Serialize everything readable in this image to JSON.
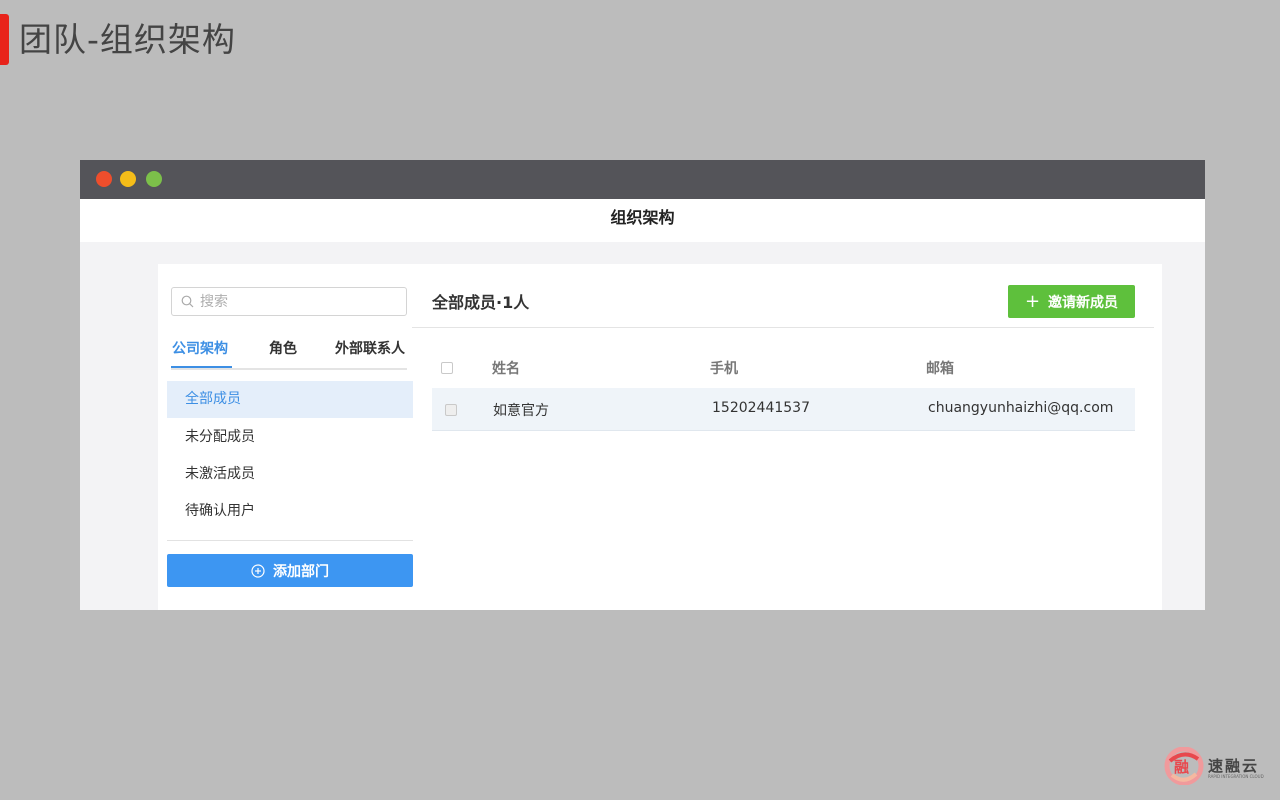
{
  "slide": {
    "title": "团队-组织架构"
  },
  "window": {
    "header_title": "组织架构"
  },
  "sidebar": {
    "search_placeholder": "搜索",
    "tabs": [
      {
        "label": "公司架构",
        "active": true
      },
      {
        "label": "角色",
        "active": false
      },
      {
        "label": "外部联系人",
        "active": false
      }
    ],
    "menu": [
      {
        "label": "全部成员",
        "active": true
      },
      {
        "label": "未分配成员",
        "active": false
      },
      {
        "label": "未激活成员",
        "active": false
      },
      {
        "label": "待确认用户",
        "active": false
      }
    ],
    "add_department_label": "添加部门"
  },
  "main": {
    "title": "全部成员·1人",
    "invite_label": "邀请新成员",
    "table": {
      "columns": [
        "姓名",
        "手机",
        "邮箱"
      ],
      "rows": [
        {
          "name": "如意官方",
          "phone": "15202441537",
          "email": "chuangyunhaizhi@qq.com"
        }
      ]
    }
  },
  "logo": {
    "text": "速融云",
    "subtext": "RAPID INTEGRATION CLOUD",
    "glyph": "融"
  },
  "colors": {
    "accent_red": "#e8231b",
    "primary_blue": "#3d96f2",
    "invite_green": "#5ec03c",
    "titlebar": "#545459",
    "active_tab": "#3d8fe4"
  }
}
